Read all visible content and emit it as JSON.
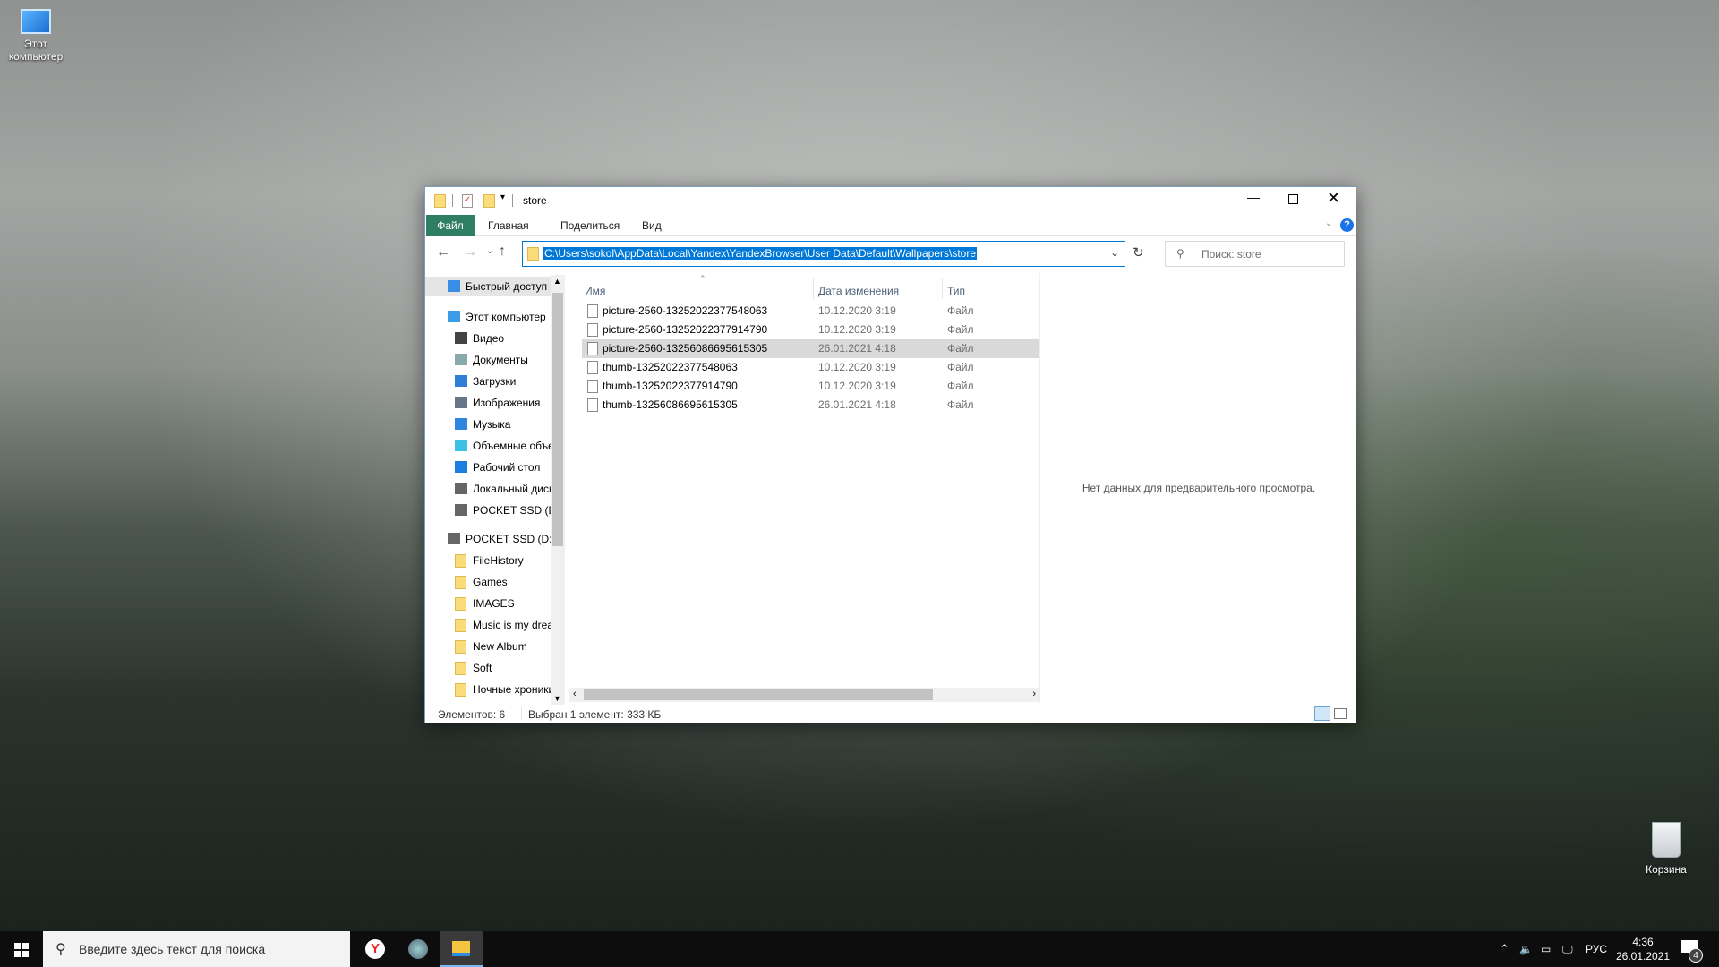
{
  "desktop": {
    "this_pc": "Этот компьютер",
    "recycle_bin": "Корзина"
  },
  "window": {
    "title": "store",
    "ribbon_tabs": [
      "Файл",
      "Главная",
      "Поделиться",
      "Вид"
    ],
    "address": "C:\\Users\\sokol\\AppData\\Local\\Yandex\\YandexBrowser\\User Data\\Default\\Wallpapers\\store",
    "search_placeholder": "Поиск: store",
    "nav": [
      {
        "label": "Быстрый доступ",
        "icon": "star-icon",
        "level": 0
      },
      {
        "label": "Этот компьютер",
        "icon": "computer-icon",
        "level": 0
      },
      {
        "label": "Видео",
        "icon": "video-icon",
        "level": 1
      },
      {
        "label": "Документы",
        "icon": "documents-icon",
        "level": 1
      },
      {
        "label": "Загрузки",
        "icon": "download-icon",
        "level": 1
      },
      {
        "label": "Изображения",
        "icon": "pictures-icon",
        "level": 1
      },
      {
        "label": "Музыка",
        "icon": "music-icon",
        "level": 1
      },
      {
        "label": "Объемные объекты",
        "icon": "3d-objects-icon",
        "level": 1
      },
      {
        "label": "Рабочий стол",
        "icon": "desktop-icon",
        "level": 1
      },
      {
        "label": "Локальный диск",
        "icon": "drive-icon",
        "level": 1
      },
      {
        "label": "POCKET SSD (D:)",
        "icon": "drive-icon",
        "level": 1
      },
      {
        "label": "POCKET SSD (D:)",
        "icon": "drive-icon",
        "level": 0
      },
      {
        "label": "FileHistory",
        "icon": "folder-icon",
        "level": 1
      },
      {
        "label": "Games",
        "icon": "folder-icon",
        "level": 1
      },
      {
        "label": "IMAGES",
        "icon": "folder-icon",
        "level": 1
      },
      {
        "label": "Music is my dream",
        "icon": "folder-icon",
        "level": 1
      },
      {
        "label": "New Album",
        "icon": "folder-icon",
        "level": 1
      },
      {
        "label": "Soft",
        "icon": "folder-icon",
        "level": 1
      },
      {
        "label": "Ночные хроники",
        "icon": "folder-icon",
        "level": 1
      }
    ],
    "columns": [
      "Имя",
      "Дата изменения",
      "Тип"
    ],
    "files": [
      {
        "name": "picture-2560-13252022377548063",
        "date": "10.12.2020 3:19",
        "type": "Файл",
        "selected": false
      },
      {
        "name": "picture-2560-13252022377914790",
        "date": "10.12.2020 3:19",
        "type": "Файл",
        "selected": false
      },
      {
        "name": "picture-2560-13256086695615305",
        "date": "26.01.2021 4:18",
        "type": "Файл",
        "selected": true
      },
      {
        "name": "thumb-13252022377548063",
        "date": "10.12.2020 3:19",
        "type": "Файл",
        "selected": false
      },
      {
        "name": "thumb-13252022377914790",
        "date": "10.12.2020 3:19",
        "type": "Файл",
        "selected": false
      },
      {
        "name": "thumb-13256086695615305",
        "date": "26.01.2021 4:18",
        "type": "Файл",
        "selected": false
      }
    ],
    "preview_text": "Нет данных для предварительного просмотра.",
    "status": {
      "count": "Элементов: 6",
      "selection": "Выбран 1 элемент: 333 КБ"
    },
    "accent": "#2f7d62"
  },
  "taskbar": {
    "search_placeholder": "Введите здесь текст для поиска",
    "lang": "РУС",
    "time": "4:36",
    "date": "26.01.2021",
    "notifications": "4"
  }
}
